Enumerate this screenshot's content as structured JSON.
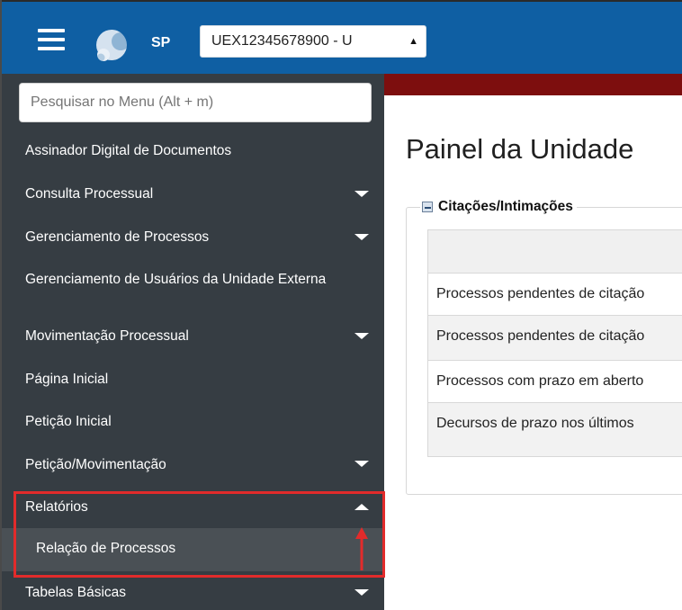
{
  "topbar": {
    "unit_code": "SP",
    "unit_select_value": "UEX12345678900 - U"
  },
  "sidebar": {
    "search_placeholder": "Pesquisar no Menu (Alt + m)",
    "items": [
      {
        "label": "Assinador Digital de Documentos",
        "has_children": false
      },
      {
        "label": "Consulta Processual",
        "has_children": true
      },
      {
        "label": "Gerenciamento de Processos",
        "has_children": true
      },
      {
        "label": "Gerenciamento de Usuários da Unidade Externa",
        "has_children": false
      },
      {
        "label": "Movimentação Processual",
        "has_children": true
      },
      {
        "label": "Página Inicial",
        "has_children": false
      },
      {
        "label": "Petição Inicial",
        "has_children": false
      },
      {
        "label": "Petição/Movimentação",
        "has_children": true
      },
      {
        "label": "Relatórios",
        "has_children": true,
        "expanded": true
      },
      {
        "label": "Relação de Processos",
        "submenu": true
      },
      {
        "label": "Tabelas Básicas",
        "has_children": true
      }
    ]
  },
  "main": {
    "page_title": "Painel da Unidade",
    "panel": {
      "legend": "Citações/Intimações",
      "rows": [
        "Processos pendentes de citação",
        "Processos pendentes de citação",
        "Processos com prazo em aberto",
        "Decursos de prazo nos últimos"
      ]
    }
  },
  "colors": {
    "topbar": "#0f5fa3",
    "sidebar": "#363d43",
    "submenu": "#4a5055",
    "strip": "#7d0e0e",
    "highlight": "#e22b2b"
  }
}
